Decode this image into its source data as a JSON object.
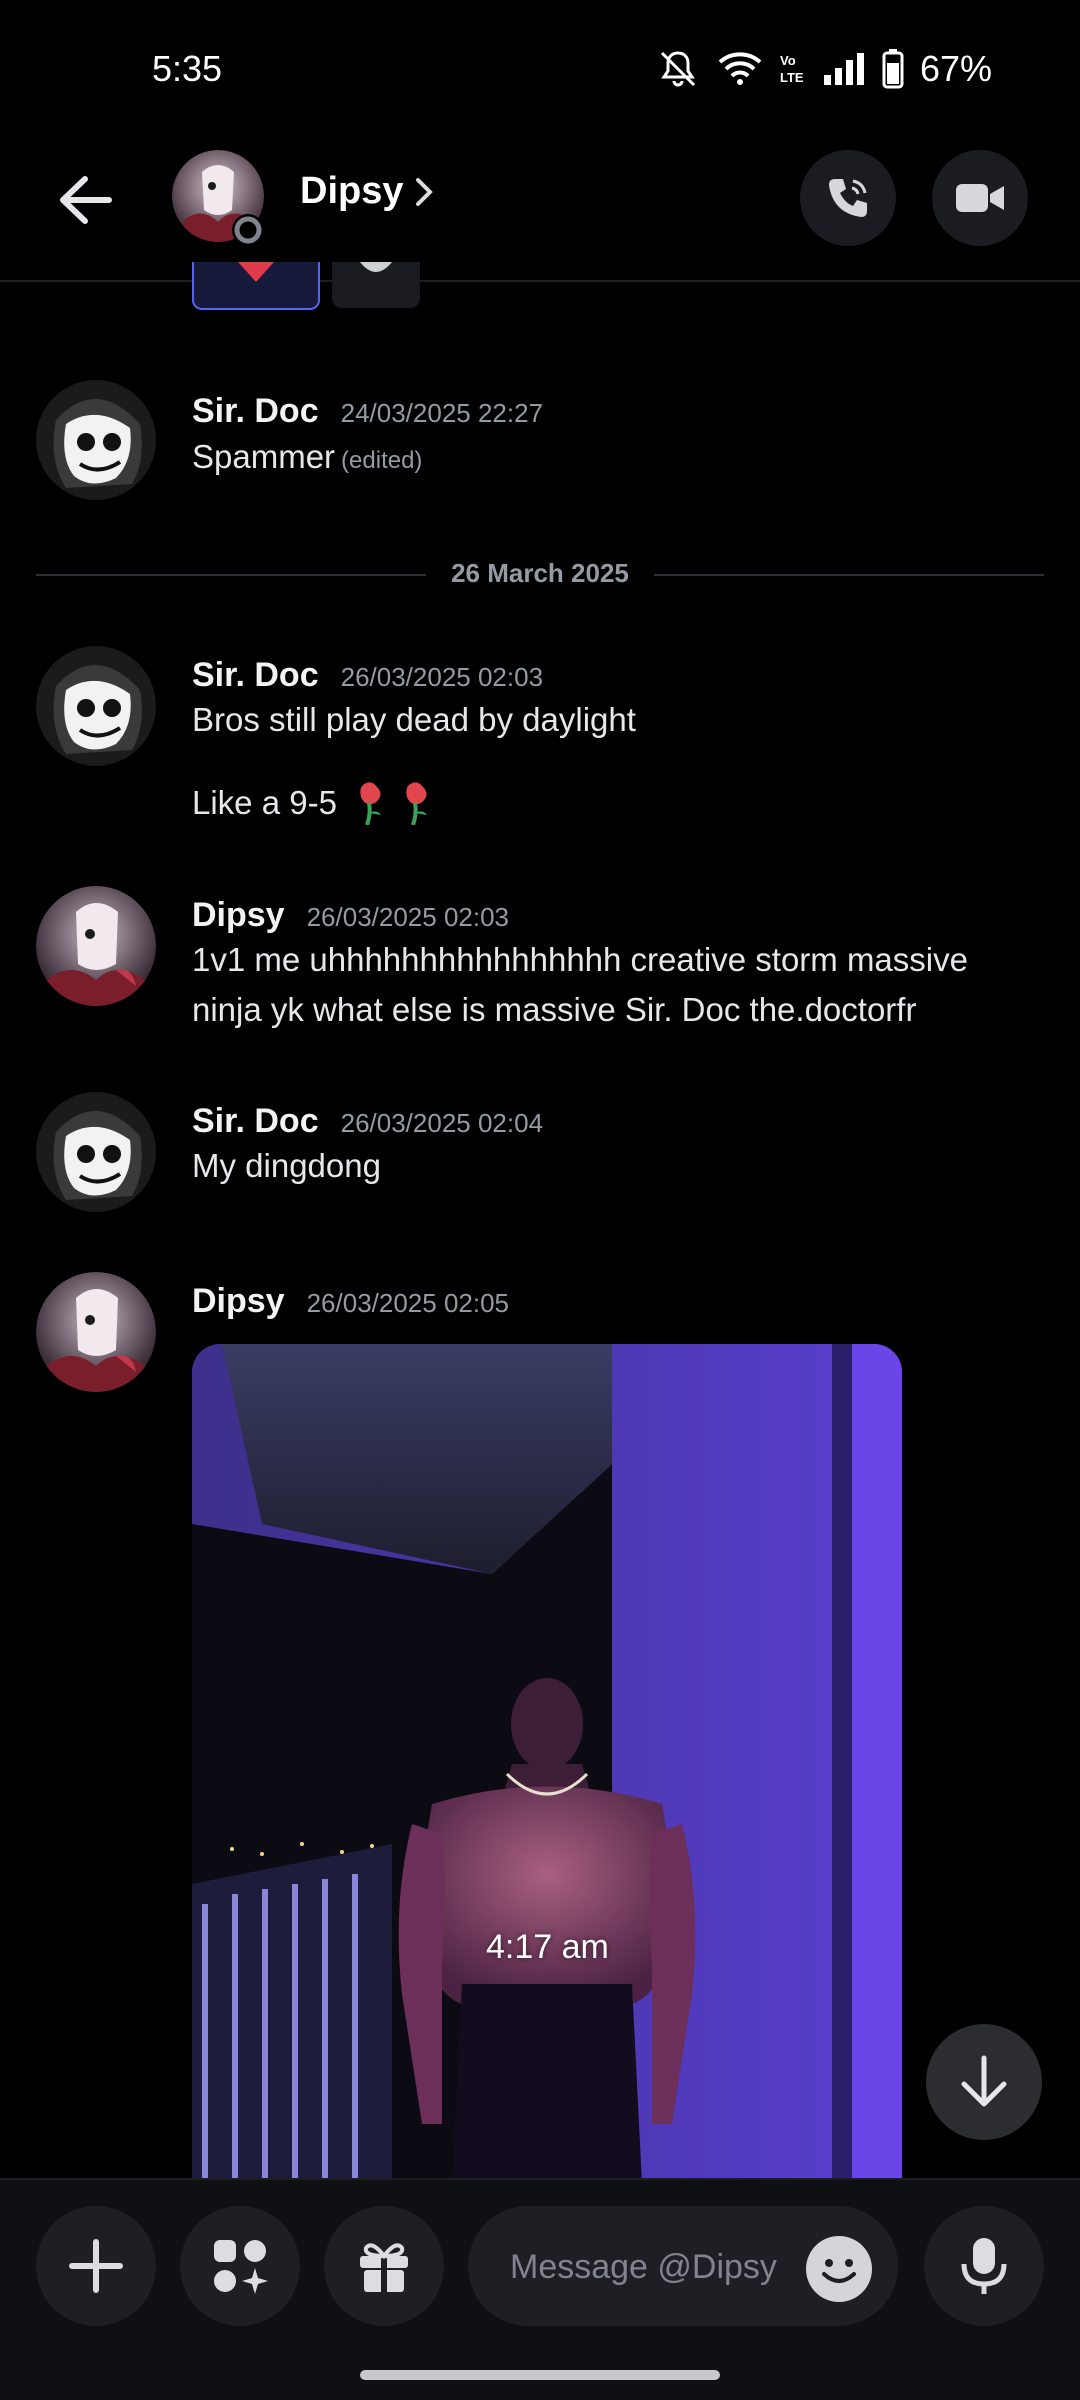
{
  "status_bar": {
    "time": "5:35",
    "battery": "67%"
  },
  "header": {
    "name": "Dipsy"
  },
  "date_separator": "26 March 2025",
  "messages": [
    {
      "author": "Sir. Doc",
      "timestamp": "24/03/2025 22:27",
      "text": "Spammer",
      "edited": "(edited)"
    },
    {
      "author": "Sir. Doc",
      "timestamp": "26/03/2025 02:03",
      "text": "Bros still play dead by daylight",
      "text2": "Like a 9-5"
    },
    {
      "author": "Dipsy",
      "timestamp": "26/03/2025 02:03",
      "line1": "1v1 me uhhhhhhhhhhhhhhhh creative storm massive",
      "line2": "ninja yk what else is massive Sir. Doc the.doctorfr"
    },
    {
      "author": "Sir. Doc",
      "timestamp": "26/03/2025 02:04",
      "text": "My dingdong"
    },
    {
      "author": "Dipsy",
      "timestamp": "26/03/2025 02:05",
      "attachment_caption": "4:17 am"
    }
  ],
  "composer": {
    "placeholder": "Message @Dipsy"
  },
  "colors": {
    "accent": "#5865f2",
    "background": "#000000",
    "input_bg": "#1e1f24"
  }
}
